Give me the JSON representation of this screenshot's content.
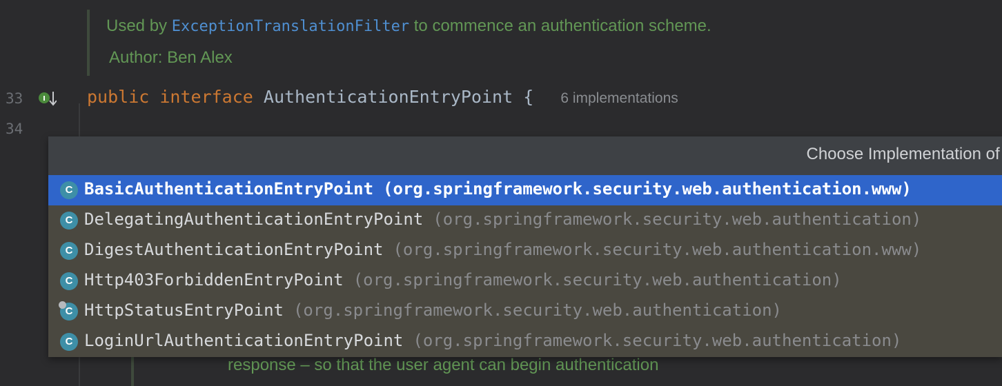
{
  "doc": {
    "line1_pre": "Used by",
    "line1_link": "ExceptionTranslationFilter",
    "line1_post": "to commence an authentication scheme.",
    "author_label": "Author:",
    "author_name": "Ben Alex"
  },
  "gutter": {
    "line_33": "33",
    "line_34": "34"
  },
  "code": {
    "kw_public": "public",
    "kw_interface": "interface",
    "type_name": "AuthenticationEntryPoint",
    "brace": "{",
    "hint": "6 implementations"
  },
  "popup": {
    "title": "Choose Implementation of A",
    "items": [
      {
        "icon": "C",
        "name": "BasicAuthenticationEntryPoint",
        "pkg": "(org.springframework.security.web.authentication.www)"
      },
      {
        "icon": "C",
        "name": "DelegatingAuthenticationEntryPoint",
        "pkg": "(org.springframework.security.web.authentication)"
      },
      {
        "icon": "C",
        "name": "DigestAuthenticationEntryPoint",
        "pkg": "(org.springframework.security.web.authentication.www)"
      },
      {
        "icon": "C",
        "name": "Http403ForbiddenEntryPoint",
        "pkg": "(org.springframework.security.web.authentication)"
      },
      {
        "icon": "C",
        "name": "HttpStatusEntryPoint",
        "pkg": "(org.springframework.security.web.authentication)"
      },
      {
        "icon": "C",
        "name": "LoginUrlAuthenticationEntryPoint",
        "pkg": "(org.springframework.security.web.authentication)"
      }
    ]
  },
  "behind": {
    "text": "response – so that the user agent can begin authentication"
  },
  "colors": {
    "selection": "#2f65ca",
    "doc_green": "#629755",
    "keyword_orange": "#cc7832",
    "link_blue": "#4f8fd1",
    "class_icon": "#3e8fa7"
  }
}
